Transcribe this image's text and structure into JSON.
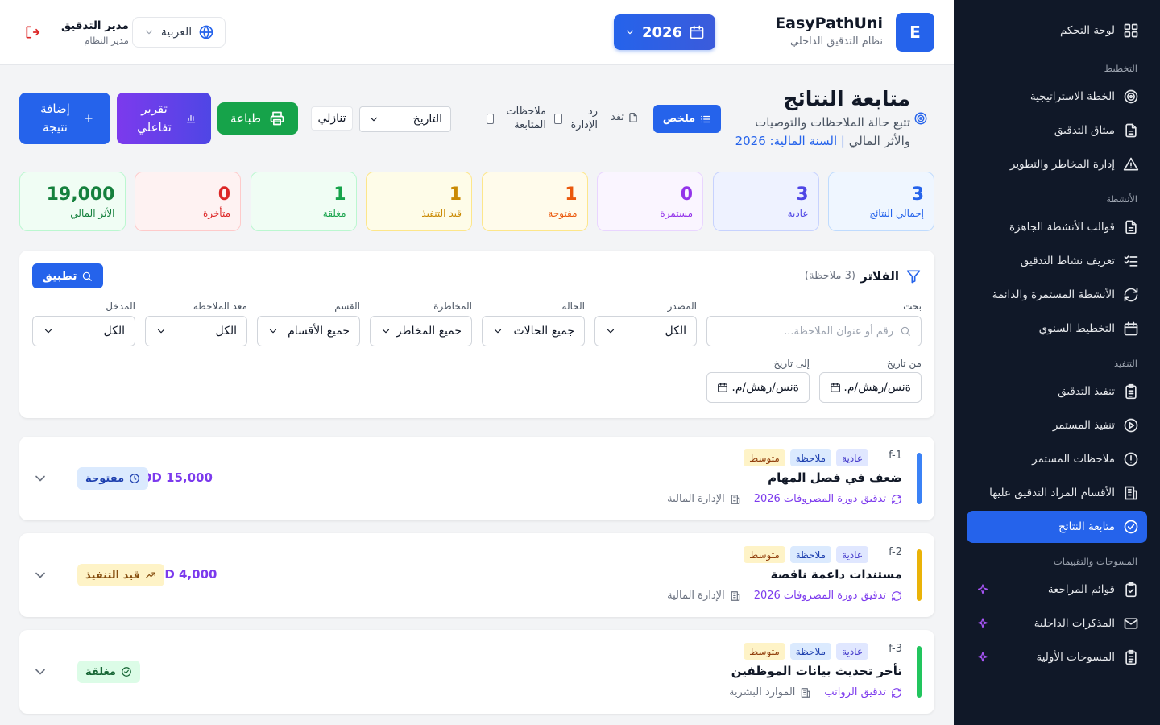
{
  "sidebar": {
    "dashboard": "لوحة التحكم",
    "sections": {
      "planning": "التخطيط",
      "activities": "الأنشطة",
      "execution": "التنفيذ",
      "surveys": "المسوحات والتقييمات"
    },
    "planning_items": [
      "الخطة الاستراتيجية",
      "ميثاق التدقيق",
      "إدارة المخاطر والتطوير"
    ],
    "activity_items": [
      "قوالب الأنشطة الجاهزة",
      "تعريف نشاط التدقيق",
      "الأنشطة المستمرة والدائمة",
      "التخطيط السنوي"
    ],
    "execution_items": [
      "تنفيذ التدقيق",
      "تنفيذ المستمر",
      "ملاحظات المستمر",
      "الأقسام المراد التدقيق عليها",
      "متابعة النتائج"
    ],
    "survey_items": [
      "قوائم المراجعة",
      "المذكرات الداخلية",
      "المسوحات الأولية"
    ]
  },
  "header": {
    "logo_letter": "E",
    "brand_name": "EasyPathUni",
    "brand_sub": "نظام التدقيق الداخلي",
    "year": "2026",
    "language": "العربية",
    "user_name": "مدير التدقيق",
    "user_role": "مدير النظام"
  },
  "page": {
    "title": "متابعة النتائج",
    "subtitle_1": "تتبع حالة الملاحظات والتوصيات",
    "subtitle_2": "والأثر المالي",
    "fiscal_year": "| السنة المالية: 2026",
    "view_summary": "ملخص",
    "view_detail": "تفد",
    "chk_admin_reply": "رد الإدارة",
    "chk_follow_notes": "ملاحظات المتابعة",
    "sort_by": "التاريخ",
    "sort_dir": "تنازلي",
    "print": "طباعة",
    "report": "تقرير تفاعلي",
    "add_result": "إضافة نتيجة"
  },
  "stats": [
    {
      "label": "إجمالي النتائج",
      "value": "3",
      "color": "#2563eb",
      "bg": "#eff6ff",
      "border": "#bfdbfe"
    },
    {
      "label": "عادية",
      "value": "3",
      "color": "#4f46e5",
      "bg": "#eef2ff",
      "border": "#c7d2fe"
    },
    {
      "label": "مستمرة",
      "value": "0",
      "color": "#9333ea",
      "bg": "#faf5ff",
      "border": "#e9d5ff"
    },
    {
      "label": "مفتوحة",
      "value": "1",
      "color": "#ea580c",
      "bg": "#fffbeb",
      "border": "#fde68a"
    },
    {
      "label": "قيد التنفيذ",
      "value": "1",
      "color": "#ca8a04",
      "bg": "#fefce8",
      "border": "#fde68a"
    },
    {
      "label": "مغلقة",
      "value": "1",
      "color": "#16a34a",
      "bg": "#f0fdf4",
      "border": "#bbf7d0"
    },
    {
      "label": "متأخرة",
      "value": "0",
      "color": "#dc2626",
      "bg": "#fef2f2",
      "border": "#fecaca"
    },
    {
      "label": "الأثر المالي",
      "value": "19,000",
      "color": "#15803d",
      "bg": "#f0fdf4",
      "border": "#bbf7d0"
    }
  ],
  "filters": {
    "title": "الفلاتر",
    "count": "(3 ملاحظة)",
    "apply": "تطبيق",
    "search_label": "بحث",
    "search_placeholder": "رقم أو عنوان الملاحظة...",
    "source_label": "المصدر",
    "source_value": "الكل",
    "status_label": "الحالة",
    "status_value": "جميع الحالات",
    "risk_label": "المخاطرة",
    "risk_value": "جميع المخاطر",
    "dept_label": "القسم",
    "dept_value": "جميع الأقسام",
    "rate_label": "معد الملاحظة",
    "rate_value": "الكل",
    "entry_label": "المدخل",
    "entry_value": "الكل",
    "from_label": "من تاريخ",
    "from_value": "ةنس/رهش/م.",
    "to_label": "إلى تاريخ",
    "to_value": "ةنس/رهش/م."
  },
  "findings": [
    {
      "code": "f-1",
      "tags": [
        "عادية",
        "ملاحظة",
        "متوسط"
      ],
      "title": "ضعف في فصل المهام",
      "source": "تدقيق دورة المصروفات 2026",
      "department": "الإدارة المالية",
      "amount": "JOD 15,000",
      "status": "مفتوحة",
      "bar_color": "#3b82f6",
      "status_bg": "#dbeafe",
      "status_color": "#1e40af"
    },
    {
      "code": "f-2",
      "tags": [
        "عادية",
        "ملاحظة",
        "متوسط"
      ],
      "title": "مستندات داعمة ناقصة",
      "source": "تدقيق دورة المصروفات 2026",
      "department": "الإدارة المالية",
      "amount": "JOD 4,000",
      "status": "قيد التنفيذ",
      "bar_color": "#eab308",
      "status_bg": "#fef3c7",
      "status_color": "#854d0e"
    },
    {
      "code": "f-3",
      "tags": [
        "عادية",
        "ملاحظة",
        "متوسط"
      ],
      "title": "تأخر تحديث بيانات الموظفين",
      "source": "تدقيق الرواتب",
      "department": "الموارد البشرية",
      "amount": "",
      "status": "مغلقة",
      "bar_color": "#22c55e",
      "status_bg": "#dcfce7",
      "status_color": "#166534"
    }
  ]
}
